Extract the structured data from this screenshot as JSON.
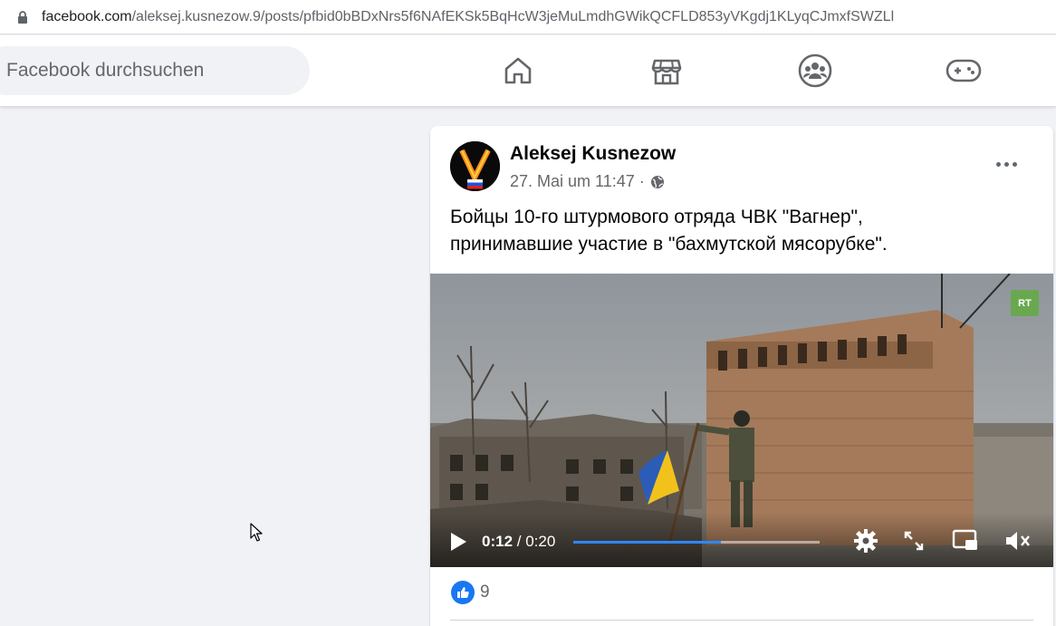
{
  "browser": {
    "url_domain": "facebook.com",
    "url_path": "/aleksej.kusnezow.9/posts/pfbid0bBDxNrs5f6NAfEKSk5BqHcW3jeMuLmdhGWikQCFLD853yVKgdj1KLyqCJmxfSWZLl",
    "lock_icon": "lock-icon"
  },
  "header": {
    "search_placeholder": "Facebook durchsuchen",
    "nav_icons": [
      "home-icon",
      "marketplace-icon",
      "groups-icon",
      "gaming-icon"
    ]
  },
  "post": {
    "author": "Aleksej Kusnezow",
    "timestamp": "27. Mai um 11:47 ·",
    "privacy_icon": "globe-icon",
    "text_line1": "Бойцы 10-го штурмового отряда ЧВК \"Вагнер\",",
    "text_line2": "принимавшие участие в \"бахмутской мясорубке\".",
    "video": {
      "watermark": "RT",
      "current_time": "0:12",
      "separator": " / ",
      "duration": "0:20",
      "progress_fraction": 0.6,
      "controls": [
        "play-icon",
        "settings-icon",
        "fullscreen-icon",
        "picture-in-picture-icon",
        "mute-icon"
      ]
    },
    "reactions": {
      "icon": "like-icon",
      "count": "9"
    }
  },
  "colors": {
    "brand": "#1877f2",
    "progress": "#2d88ff",
    "background": "#f0f2f5"
  }
}
